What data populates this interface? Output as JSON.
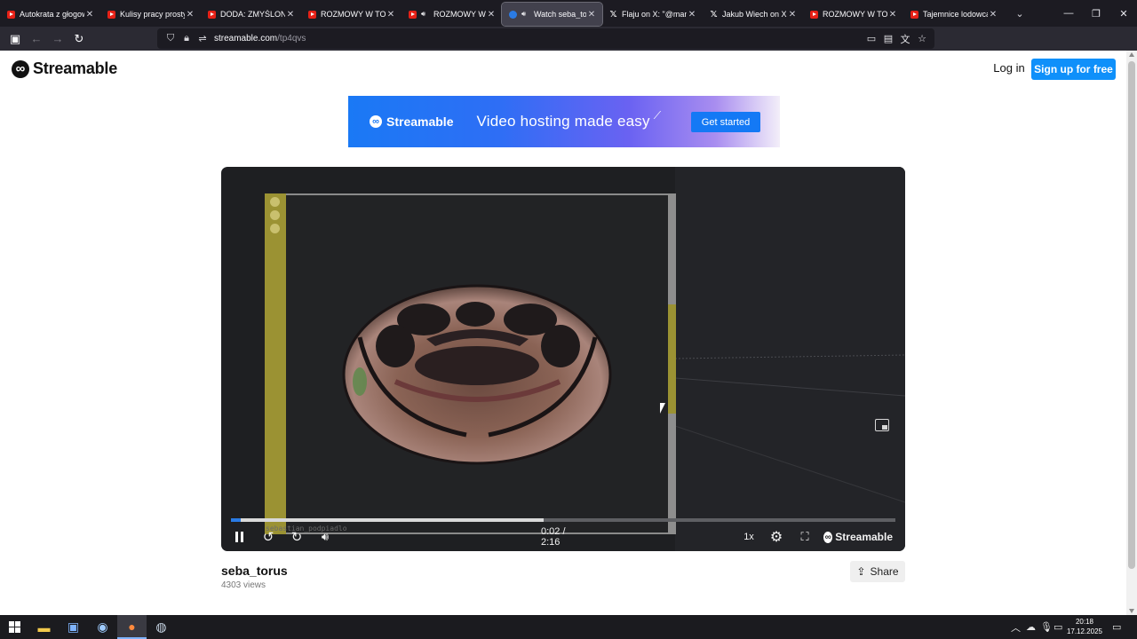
{
  "browser": {
    "tabs": [
      {
        "title": "Autokrata z głogowsk",
        "favicon": "youtube-icon",
        "active": false,
        "audio": false
      },
      {
        "title": "Kulisy pracy prostytu",
        "favicon": "youtube-icon",
        "active": false,
        "audio": false
      },
      {
        "title": "DODA: ZMYŚLONE ZA",
        "favicon": "youtube-icon",
        "active": false,
        "audio": false
      },
      {
        "title": "ROZMOWY W TOKU",
        "favicon": "youtube-icon",
        "active": false,
        "audio": false
      },
      {
        "title": "ROZMOWY W TO",
        "favicon": "youtube-icon",
        "active": false,
        "audio": true
      },
      {
        "title": "Watch seba_toru",
        "favicon": "streamable-icon",
        "active": true,
        "audio": true
      },
      {
        "title": "Flaju on X: \"@mamic",
        "favicon": "x-icon",
        "active": false,
        "audio": false
      },
      {
        "title": "Jakub Wiech on X: \"Z",
        "favicon": "x-icon",
        "active": false,
        "audio": false
      },
      {
        "title": "ROZMOWY W TOKU",
        "favicon": "youtube-icon",
        "active": false,
        "audio": false
      },
      {
        "title": "Tajemnice lodowca -",
        "favicon": "youtube-icon",
        "active": false,
        "audio": false
      }
    ],
    "url_host": "streamable.com",
    "url_path": "/tp4qvs",
    "extension_badge": "3"
  },
  "site": {
    "logo_text": "Streamable",
    "login_label": "Log in",
    "signup_label": "Sign up for free"
  },
  "banner": {
    "brand": "Streamable",
    "tagline": "Video hosting made easy",
    "cta": "Get started"
  },
  "player": {
    "current_time": "0:02",
    "duration": "2:16",
    "time_display": "0:02 / 2:16",
    "played_fraction": 0.015,
    "buffered_fraction": 0.47,
    "speed": "1x",
    "brand": "Streamable",
    "watermark": "sebastian_podpiadlo"
  },
  "video": {
    "title": "seba_torus",
    "views": "4303 views",
    "share_label": "Share"
  },
  "taskbar": {
    "time": "20:18",
    "date": "17.12.2025"
  },
  "colors": {
    "accent": "#0f90fa",
    "player_progress": "#2a7be4",
    "tab_bar": "#1c1b22"
  }
}
